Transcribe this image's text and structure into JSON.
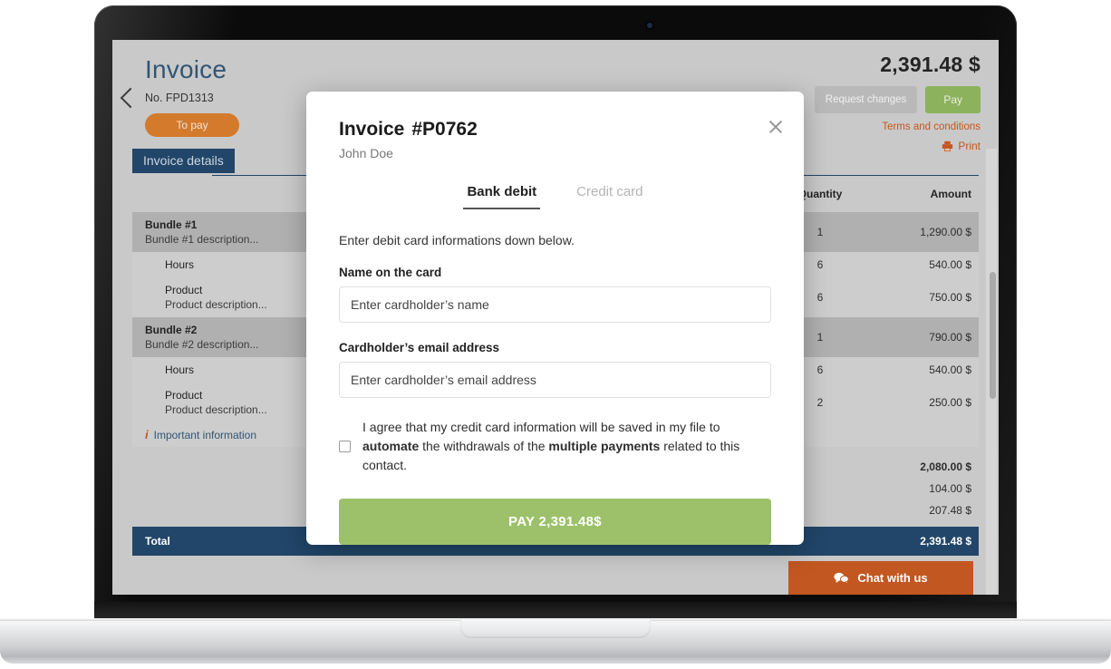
{
  "device": {
    "webcam": "webcam-dot"
  },
  "invoice": {
    "title": "Invoice",
    "number_label": "No. FPD1313",
    "status_badge": "To pay",
    "total_amount": "2,391.48 $",
    "request_changes_label": "Request changes",
    "pay_label": "Pay",
    "terms_label": "Terms and conditions",
    "print_label": "Print",
    "tab_label": "Invoice details"
  },
  "table": {
    "headers": {
      "description": "",
      "quantity": "Quantity",
      "amount": "Amount"
    },
    "rows": [
      {
        "type": "bundle",
        "title": "Bundle #1",
        "sub": "Bundle #1 description...",
        "qty": "1",
        "amount": "1,290.00 $"
      },
      {
        "type": "item",
        "title": "Hours",
        "sub": "",
        "qty": "6",
        "amount": "540.00 $"
      },
      {
        "type": "item",
        "title": "Product",
        "sub": "Product description...",
        "qty": "6",
        "amount": "750.00 $"
      },
      {
        "type": "bundle",
        "title": "Bundle #2",
        "sub": "Bundle #2 description...",
        "qty": "1",
        "amount": "790.00 $"
      },
      {
        "type": "item",
        "title": "Hours",
        "sub": "",
        "qty": "6",
        "amount": "540.00 $"
      },
      {
        "type": "item",
        "title": "Product",
        "sub": "Product description...",
        "qty": "2",
        "amount": "250.00 $"
      }
    ],
    "important_information": "Important information",
    "totals": {
      "subtotal": "2,080.00 $",
      "tax1": "104.00 $",
      "tax2": "207.48 $",
      "total_label": "Total",
      "total_value": "2,391.48 $"
    }
  },
  "chat": {
    "label": "Chat with us"
  },
  "modal": {
    "title": "Invoice",
    "number": "#P0762",
    "customer": "John Doe",
    "tabs": [
      {
        "label": "Bank debit",
        "active": true
      },
      {
        "label": "Credit card",
        "active": false
      }
    ],
    "intro": "Enter debit card informations down below.",
    "name_label": "Name on the card",
    "name_value": "",
    "name_placeholder": "Enter cardholder’s name",
    "email_label": "Cardholder’s email address",
    "email_value": "",
    "email_placeholder": "Enter cardholder’s email address",
    "consent": {
      "part1": "I agree that my credit card information will be saved in my file to ",
      "bold1": "automate",
      "part2": " the withdrawals of the ",
      "bold2": "multiple payments",
      "part3": " related to this contact.",
      "checked": false
    },
    "pay_button": "PAY 2,391.48$"
  },
  "colors": {
    "navy": "#1f4468",
    "orange": "#c2561f",
    "badge_orange": "#d4792a",
    "green": "#9cc16a",
    "header_green": "#8cb25c",
    "screen_bg": "#c9c9c9",
    "row_bundle": "#b0b0b0",
    "row_item": "#cdcdcd"
  }
}
